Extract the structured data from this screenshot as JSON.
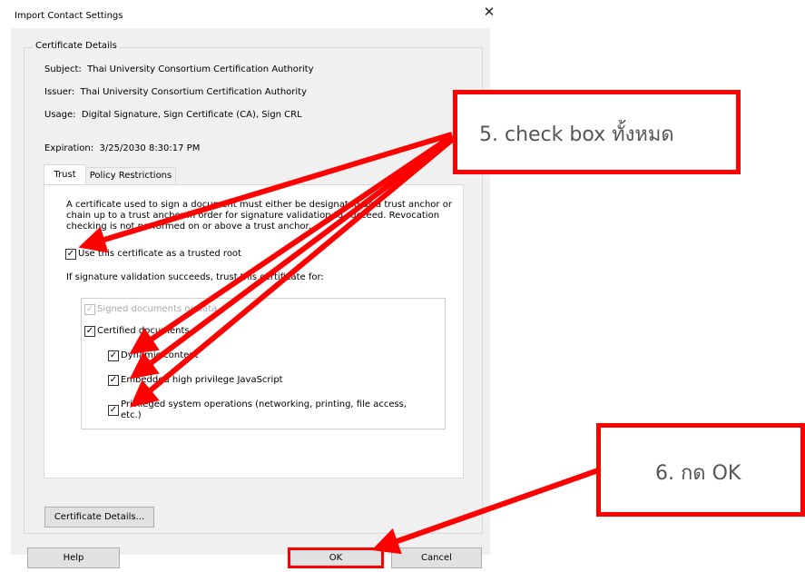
{
  "window": {
    "title": "Import Contact Settings",
    "close_glyph": "✕"
  },
  "certificate_details": {
    "group_label": "Certificate Details",
    "subject_label": "Subject:",
    "subject_value": "Thai University Consortium Certification Authority",
    "issuer_label": "Issuer:",
    "issuer_value": "Thai University Consortium Certification Authority",
    "usage_label": "Usage:",
    "usage_value": "Digital Signature, Sign Certificate (CA), Sign CRL",
    "expiration_label": "Expiration:",
    "expiration_value": "3/25/2030 8:30:17 PM"
  },
  "tabs": [
    {
      "label": "Trust",
      "active": true
    },
    {
      "label": "Policy Restrictions",
      "active": false
    }
  ],
  "trust": {
    "description": "A certificate used to sign a document must either be designated as a trust anchor or chain up to a trust anchor in order for signature validation to succeed.  Revocation checking is not performed on or above a trust anchor.",
    "use_as_trusted_root": {
      "label": "Use this certificate as a trusted root",
      "checked": true
    },
    "trust_for_heading": "If signature validation succeeds, trust this certificate for:",
    "options": [
      {
        "label": "Signed documents or data",
        "checked": true,
        "disabled": true
      },
      {
        "label": "Certified documents",
        "checked": true,
        "disabled": false
      },
      {
        "label": "Dynamic content",
        "checked": true,
        "disabled": false
      },
      {
        "label": "Embedded high privilege JavaScript",
        "checked": true,
        "disabled": false
      },
      {
        "label": "Privileged system operations (networking, printing, file access, etc.)",
        "checked": true,
        "disabled": false
      }
    ]
  },
  "buttons": {
    "certificate_details": "Certificate Details...",
    "help": "Help",
    "ok": "OK",
    "cancel": "Cancel"
  },
  "check_glyph": "✓",
  "annotations": {
    "step5": "5. check box ทั้งหมด",
    "step6": "6. กด OK",
    "highlight_color": "#ff0000"
  }
}
